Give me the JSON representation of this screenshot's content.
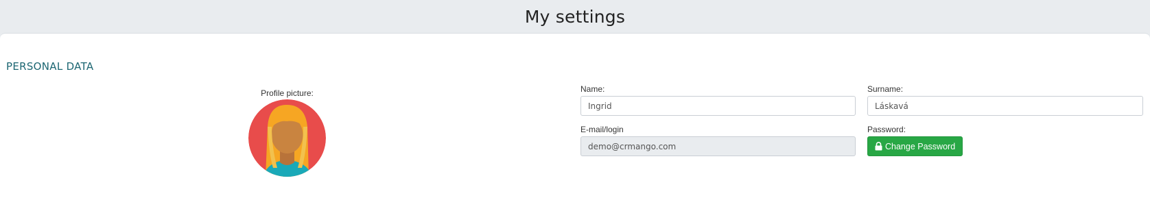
{
  "page": {
    "title": "My settings"
  },
  "personal": {
    "section_title": "PERSONAL DATA",
    "profile_picture_label": "Profile picture:",
    "avatar_icon": "female-avatar-icon",
    "name_label": "Name:",
    "name_value": "Ingrid",
    "surname_label": "Surname:",
    "surname_value": "Láskavá",
    "email_label": "E-mail/login",
    "email_value": "demo@crmango.com",
    "password_label": "Password:",
    "change_password_label": "Change Password"
  },
  "colors": {
    "header_bg": "#e9ecef",
    "section_title": "#1c6672",
    "button_green": "#28a745",
    "avatar_bg": "#e84c4b"
  }
}
